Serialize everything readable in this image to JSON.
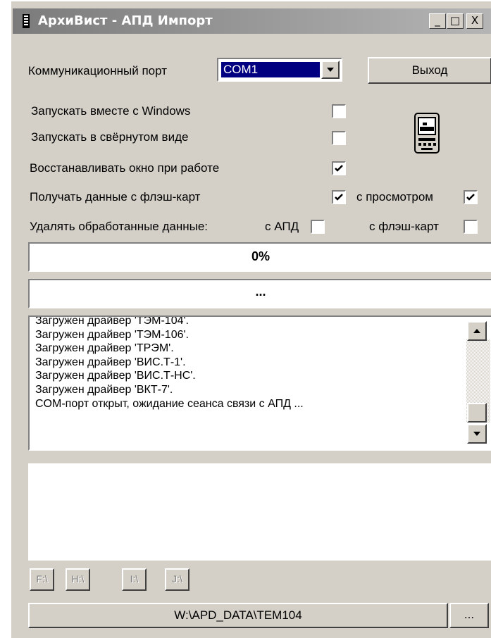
{
  "window": {
    "title": "АрхиВист - АПД Импорт",
    "caption_buttons": {
      "minimize": "_",
      "maximize": "□",
      "close": "X"
    }
  },
  "port": {
    "label": "Коммуникационный порт",
    "selected": "COM1",
    "exit_label": "Выход"
  },
  "options": [
    {
      "label": "Запускать вместе с Windows",
      "checked": false
    },
    {
      "label": "Запускать в свёрнутом виде",
      "checked": false
    },
    {
      "label": "Восстанавливать окно при работе",
      "checked": true
    },
    {
      "label": "Получать данные с флэш-карт",
      "checked": true
    }
  ],
  "with_preview": {
    "label": "с просмотром",
    "checked": true
  },
  "delete": {
    "label": "Удалять обработанные данные:",
    "apd_label": "с АПД",
    "apd_checked": false,
    "flash_label": "с флэш-карт",
    "flash_checked": false
  },
  "progress": {
    "percent_text": "0%",
    "status_text": "..."
  },
  "log": {
    "lines": [
      "Загружен драйвер 'ТЭМ-104'.",
      "Загружен драйвер 'ТЭМ-106'.",
      "Загружен драйвер 'ТРЭМ'.",
      "Загружен драйвер 'ВИС.Т-1'.",
      "Загружен драйвер 'ВИС.Т-НС'.",
      "Загружен драйвер 'ВКТ-7'.",
      "COM-порт открыт, ожидание сеанса связи с АПД ..."
    ]
  },
  "drives": [
    "F:\\",
    "H:\\",
    "I:\\",
    "J:\\"
  ],
  "path": {
    "value": "W:\\APD_DATA\\TEM104",
    "browse_label": "..."
  },
  "icons": {
    "app": "tower-icon",
    "device": "pda-device-icon"
  }
}
